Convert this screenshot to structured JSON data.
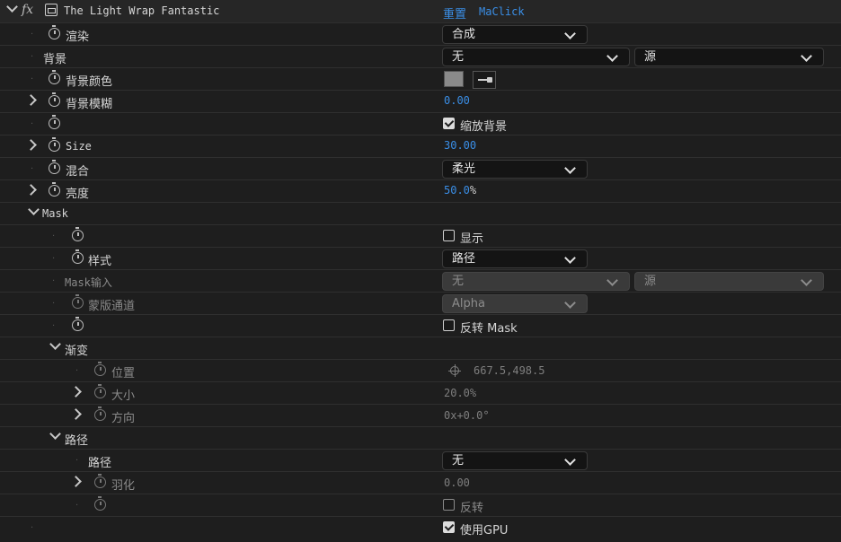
{
  "effect": {
    "title": "The Light Wrap Fantastic",
    "reset_label": "重置",
    "brand_label": "MaClick"
  },
  "rows": {
    "render": {
      "label": "渲染",
      "value": "合成"
    },
    "background": {
      "label": "背景",
      "value": "无",
      "source": "源"
    },
    "bg_color": {
      "label": "背景颜色",
      "color": "#8a8a8a"
    },
    "bg_blur": {
      "label": "背景模糊",
      "value": "0.00"
    },
    "scale_bg": {
      "checkbox_label": "缩放背景",
      "checked": true
    },
    "size": {
      "label": "Size",
      "value": "30.00"
    },
    "blend": {
      "label": "混合",
      "value": "柔光"
    },
    "brightness": {
      "label": "亮度",
      "value": "50.0",
      "unit": "%"
    },
    "mask_group": {
      "label": "Mask"
    },
    "show": {
      "checkbox_label": "显示",
      "checked": false
    },
    "style": {
      "label": "样式",
      "value": "路径"
    },
    "mask_input": {
      "label": "Mask输入",
      "value": "无",
      "source": "源"
    },
    "matte_channel": {
      "label": "蒙版通道",
      "value": "Alpha"
    },
    "invert_mask": {
      "checkbox_label": "反转 Mask",
      "checked": false
    },
    "gradient_group": {
      "label": "渐变"
    },
    "position": {
      "label": "位置",
      "value": "667.5,498.5"
    },
    "grad_size": {
      "label": "大小",
      "value": "20.0%"
    },
    "direction": {
      "label": "方向",
      "value": "0x+0.0°"
    },
    "path_group": {
      "label": "路径"
    },
    "path": {
      "label": "路径",
      "value": "无"
    },
    "feather": {
      "label": "羽化",
      "value": "0.00"
    },
    "invert": {
      "checkbox_label": "反转",
      "checked": false
    },
    "use_gpu": {
      "checkbox_label": "使用GPU",
      "checked": true
    }
  }
}
